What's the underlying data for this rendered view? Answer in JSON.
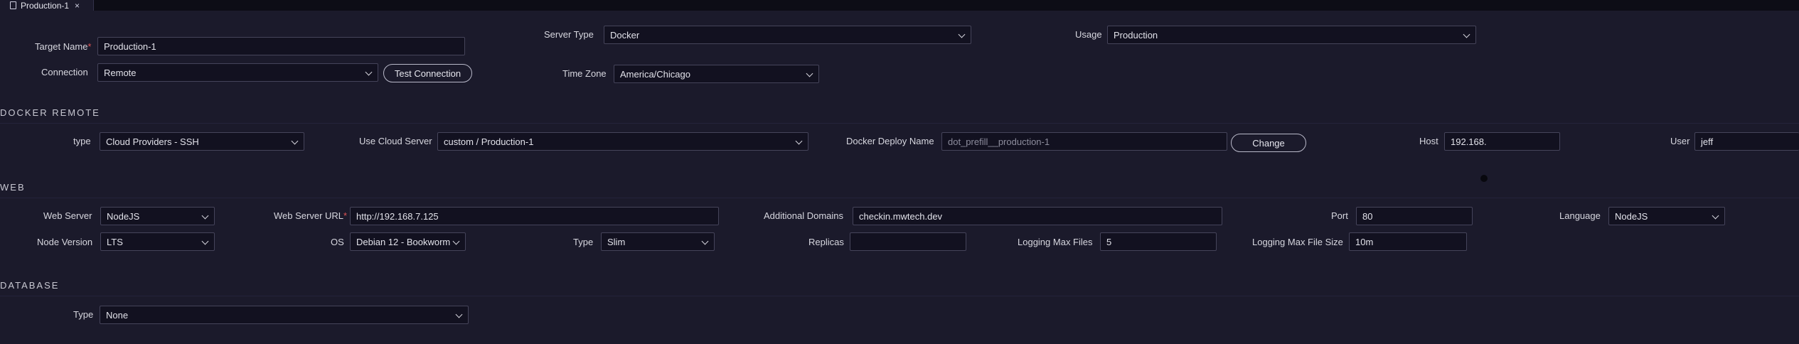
{
  "tab": {
    "label": "Production-1",
    "close": "×"
  },
  "target": {
    "target_name_label": "Target Name",
    "required_mark": "*",
    "target_name_value": "Production-1",
    "server_type_label": "Server Type",
    "server_type_value": "Docker",
    "usage_label": "Usage",
    "usage_value": "Production",
    "connection_label": "Connection",
    "connection_value": "Remote",
    "test_connection_label": "Test Connection",
    "time_zone_label": "Time Zone",
    "time_zone_value": "America/Chicago"
  },
  "docker_remote": {
    "section_title": "DOCKER REMOTE",
    "type_label": "type",
    "type_value": "Cloud Providers - SSH",
    "use_cloud_server_label": "Use Cloud Server",
    "use_cloud_server_value": "custom / Production-1",
    "deploy_name_label": "Docker Deploy Name",
    "deploy_name_placeholder": "dot_prefill__production-1",
    "change_label": "Change",
    "host_label": "Host",
    "host_value": "192.168.",
    "user_label": "User",
    "user_value": "jeff"
  },
  "web": {
    "section_title": "WEB",
    "web_server_label": "Web Server",
    "web_server_value": "NodeJS",
    "web_server_url_label": "Web Server URL",
    "web_server_url_value": "http://192.168.7.125",
    "additional_domains_label": "Additional Domains",
    "additional_domains_value": "checkin.mwtech.dev",
    "port_label": "Port",
    "port_value": "80",
    "language_label": "Language",
    "language_value": "NodeJS",
    "node_version_label": "Node Version",
    "node_version_value": "LTS",
    "os_label": "OS",
    "os_value": "Debian 12 - Bookworm",
    "type_label": "Type",
    "type_value": "Slim",
    "replicas_label": "Replicas",
    "replicas_value": "",
    "logging_max_files_label": "Logging Max Files",
    "logging_max_files_value": "5",
    "logging_max_file_size_label": "Logging Max File Size",
    "logging_max_file_size_value": "10m"
  },
  "database": {
    "section_title": "DATABASE",
    "type_label": "Type",
    "type_value": "None"
  },
  "icons": {
    "tab_icon": "document-icon",
    "dropdown_icon": "chevron-down-icon",
    "indicator": "status-dot"
  },
  "colors": {
    "background": "#1b1a2b",
    "input_bg": "#121120",
    "required": "#e05555",
    "tabbar": "#0d0d16"
  }
}
